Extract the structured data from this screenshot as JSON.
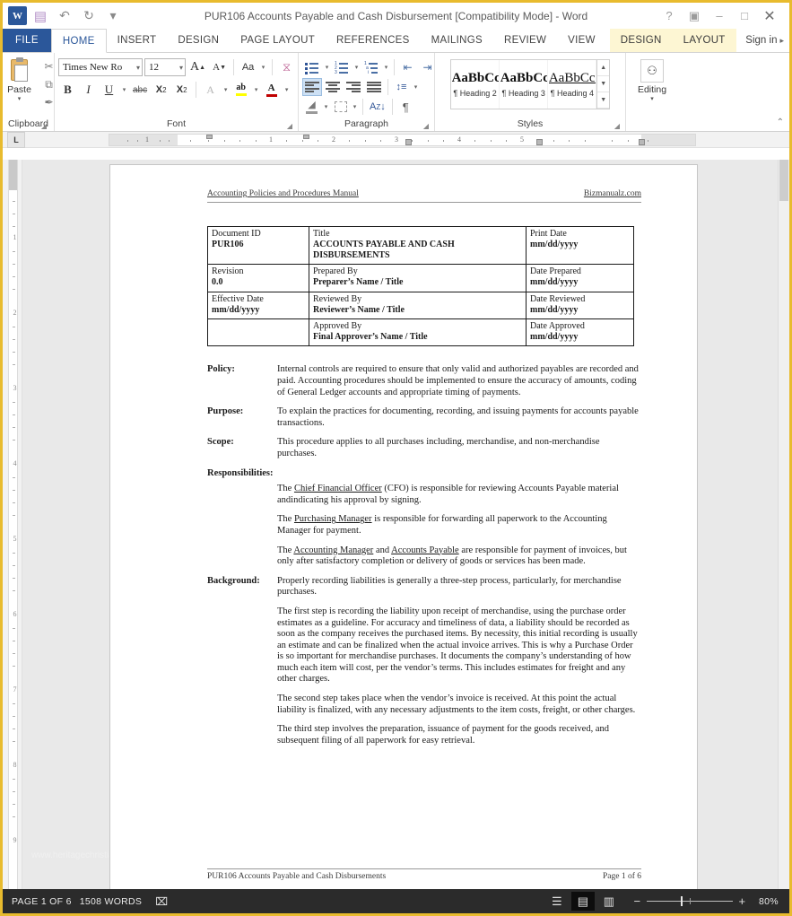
{
  "window": {
    "title": "PUR106 Accounts Payable and Cash Disbursement [Compatibility Mode] - Word",
    "app_icon": "W",
    "quick_access": [
      {
        "name": "save-icon",
        "glyph": "▤"
      },
      {
        "name": "undo-icon",
        "glyph": "↶"
      },
      {
        "name": "redo-icon",
        "glyph": "↻"
      },
      {
        "name": "customize-qat-icon",
        "glyph": "▾"
      }
    ],
    "controls": [
      {
        "name": "help-button",
        "glyph": "?"
      },
      {
        "name": "ribbon-display-options-button",
        "glyph": "▣"
      },
      {
        "name": "minimize-button",
        "glyph": "–"
      },
      {
        "name": "restore-button",
        "glyph": "□"
      },
      {
        "name": "close-button",
        "glyph": "✕"
      }
    ]
  },
  "tabs": {
    "file": "FILE",
    "main": [
      "HOME",
      "INSERT",
      "DESIGN",
      "PAGE LAYOUT",
      "REFERENCES",
      "MAILINGS",
      "REVIEW",
      "VIEW"
    ],
    "active": "HOME",
    "contextual": [
      "DESIGN",
      "LAYOUT"
    ],
    "signin": "Sign in"
  },
  "ribbon": {
    "clipboard": {
      "label": "Clipboard",
      "paste": "Paste",
      "tools": [
        {
          "name": "cut-icon",
          "glyph": "✂"
        },
        {
          "name": "copy-icon",
          "glyph": "⧉"
        },
        {
          "name": "format-painter-icon",
          "glyph": "✒"
        }
      ]
    },
    "font": {
      "label": "Font",
      "font_name": "Times New Ro",
      "font_size": "12",
      "buttons": [
        {
          "name": "grow-font-icon",
          "glyph": "A"
        },
        {
          "name": "shrink-font-icon",
          "glyph": "A"
        },
        {
          "name": "change-case-icon",
          "glyph": "Aa"
        },
        {
          "name": "clear-formatting-icon",
          "glyph": "✐"
        },
        {
          "name": "bold-icon",
          "glyph": "B"
        },
        {
          "name": "italic-icon",
          "glyph": "I"
        },
        {
          "name": "underline-icon",
          "glyph": "U"
        },
        {
          "name": "strikethrough-icon",
          "glyph": "abc"
        },
        {
          "name": "subscript-icon",
          "glyph": "X₂"
        },
        {
          "name": "superscript-icon",
          "glyph": "X²"
        },
        {
          "name": "text-effects-icon",
          "glyph": "A"
        },
        {
          "name": "text-highlight-color-icon",
          "glyph": "ab"
        },
        {
          "name": "font-color-icon",
          "glyph": "A"
        }
      ],
      "font_color": "#c00000",
      "highlight_color": "#ffff00"
    },
    "paragraph": {
      "label": "Paragraph",
      "buttons": [
        {
          "name": "bullets-icon"
        },
        {
          "name": "numbering-icon"
        },
        {
          "name": "multilevel-list-icon"
        },
        {
          "name": "decrease-indent-icon"
        },
        {
          "name": "increase-indent-icon"
        },
        {
          "name": "align-left-icon"
        },
        {
          "name": "align-center-icon"
        },
        {
          "name": "align-right-icon"
        },
        {
          "name": "justify-icon"
        },
        {
          "name": "line-spacing-icon"
        },
        {
          "name": "shading-icon"
        },
        {
          "name": "borders-icon"
        },
        {
          "name": "sort-icon"
        },
        {
          "name": "show-formatting-marks-icon"
        }
      ]
    },
    "styles": {
      "label": "Styles",
      "items": [
        {
          "preview": "AaBbCc",
          "name": "¶ Heading 2",
          "style": "sp-h2"
        },
        {
          "preview": "AaBbCc",
          "name": "¶ Heading 3",
          "style": "sp-h3"
        },
        {
          "preview": "AaBbCcI",
          "name": "¶ Heading 4",
          "style": "sp-h4"
        }
      ]
    },
    "editing": {
      "label": "Editing",
      "button": "Editing",
      "icon": "⚇"
    },
    "collapse_icon": "⌃"
  },
  "ruler": {
    "tab_stop": "L",
    "numbers": [
      "1",
      "1",
      "2",
      "3",
      "4",
      "5"
    ],
    "vertical_numbers": [
      "1",
      "2",
      "3",
      "4",
      "5",
      "6",
      "7",
      "8",
      "9"
    ]
  },
  "document": {
    "header": {
      "left": "Accounting Policies and Procedures Manual",
      "right": "Bizmanualz.com"
    },
    "meta_table": [
      [
        {
          "label": "Document ID",
          "value": "PUR106"
        },
        {
          "label": "Title",
          "value": "ACCOUNTS PAYABLE AND CASH DISBURSEMENTS"
        },
        {
          "label": "Print Date",
          "value": "mm/dd/yyyy"
        }
      ],
      [
        {
          "label": "Revision",
          "value": "0.0"
        },
        {
          "label": "Prepared By",
          "value": "Preparer’s Name / Title"
        },
        {
          "label": "Date Prepared",
          "value": "mm/dd/yyyy"
        }
      ],
      [
        {
          "label": "Effective Date",
          "value": "mm/dd/yyyy"
        },
        {
          "label": "Reviewed By",
          "value": "Reviewer’s Name / Title"
        },
        {
          "label": "Date Reviewed",
          "value": "mm/dd/yyyy"
        }
      ],
      [
        {
          "label": "",
          "value": ""
        },
        {
          "label": "Approved By",
          "value": "Final Approver’s Name / Title"
        },
        {
          "label": "Date Approved",
          "value": "mm/dd/yyyy"
        }
      ]
    ],
    "sections": {
      "policy_label": "Policy:",
      "policy_text": "Internal controls are required to ensure that only valid and authorized payables are recorded and paid.  Accounting procedures should be implemented to ensure the accuracy of amounts, coding of General Ledger accounts and appropriate timing of payments.",
      "purpose_label": "Purpose:",
      "purpose_text": "To explain the practices for documenting, recording, and issuing payments for accounts payable transactions.",
      "scope_label": "Scope:",
      "scope_text": "This procedure applies to all purchases including, merchandise, and non-merchandise purchases.",
      "responsibilities_label": "Responsibilities:",
      "resp_1_a": "The ",
      "resp_1_u": "Chief Financial Officer",
      "resp_1_b": " (CFO) is responsible for reviewing Accounts Payable material andindicating his approval by signing.",
      "resp_2_a": "The ",
      "resp_2_u": "Purchasing Manager",
      "resp_2_b": " is responsible for forwarding all paperwork to the Accounting Manager for payment.",
      "resp_3_a": "The ",
      "resp_3_u1": "Accounting Manager",
      "resp_3_mid": " and ",
      "resp_3_u2": "Accounts Payable",
      "resp_3_b": " are responsible for payment of invoices, but only after satisfactory completion or delivery of goods or services has been made.",
      "background_label": "Background:",
      "background_p1": "Properly recording liabilities is generally a three-step process, particularly, for merchandise purchases.",
      "background_p2": "The first step is recording the liability upon receipt of merchandise, using the purchase order estimates as a guideline.  For accuracy and timeliness of data, a liability should be recorded as soon as the company receives the purchased items.  By necessity, this initial recording is usually an estimate and can be finalized when the actual invoice arrives.  This is why a Purchase Order is so important for merchandise purchases.  It documents the company’s understanding of how much each item will cost, per the vendor’s terms.  This includes estimates for freight and any other charges.",
      "background_p3": "The second step takes place when the vendor’s invoice is received.  At this point the actual liability is finalized, with any necessary adjustments to the item costs, freight, or other charges.",
      "background_p4": "The third step involves the preparation, issuance of payment for the goods received, and subsequent filing of all paperwork for easy retrieval."
    },
    "footer": {
      "left": "PUR106 Accounts Payable and Cash Disbursements",
      "right": "Page 1 of 6"
    },
    "watermark": "www.heritagechristiancollege.com"
  },
  "statusbar": {
    "page": "PAGE 1 OF 6",
    "words": "1508 WORDS",
    "proofing_icon": "⌧",
    "views": [
      {
        "name": "read-mode-button",
        "glyph": "☰",
        "active": false
      },
      {
        "name": "print-layout-button",
        "glyph": "▤",
        "active": true
      },
      {
        "name": "web-layout-button",
        "glyph": "▥",
        "active": false
      }
    ],
    "zoom_out": "−",
    "zoom_in": "+",
    "zoom_value": "80%"
  }
}
